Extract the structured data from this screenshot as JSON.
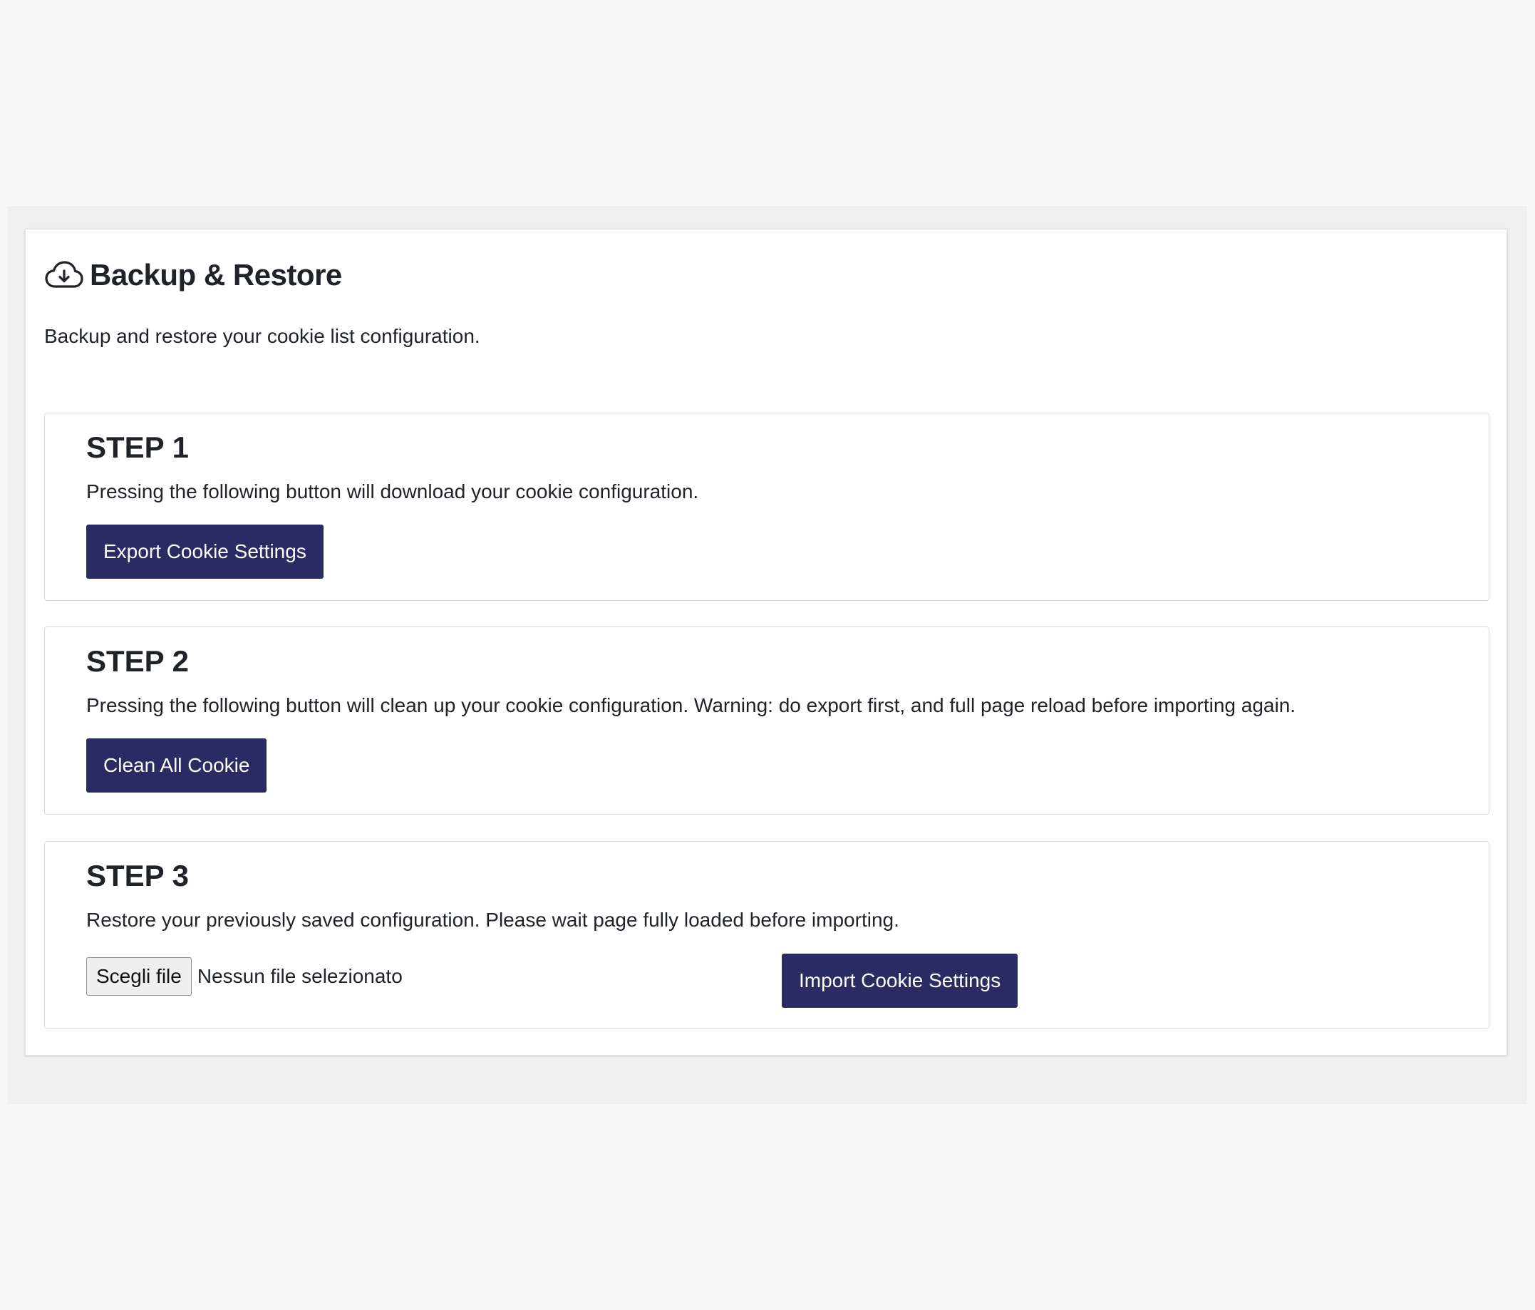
{
  "header": {
    "icon": "cloud-download-icon",
    "title": "Backup & Restore",
    "description": "Backup and restore your cookie list configuration."
  },
  "steps": [
    {
      "title": "STEP 1",
      "text": "Pressing the following button will download your cookie configuration.",
      "button_label": "Export Cookie Settings"
    },
    {
      "title": "STEP 2",
      "text": "Pressing the following button will clean up your cookie configuration. Warning: do export first, and full page reload before importing again.",
      "button_label": "Clean All Cookie"
    },
    {
      "title": "STEP 3",
      "text": "Restore your previously saved configuration. Please wait page fully loaded before importing.",
      "file_button_label": "Scegli file",
      "file_status": "Nessun file selezionato",
      "button_label": "Import Cookie Settings"
    }
  ],
  "colors": {
    "primary_button": "#2a2b62",
    "page_background": "#f8f8f8",
    "panel_background": "#f0f0f0",
    "card_background": "#ffffff"
  }
}
